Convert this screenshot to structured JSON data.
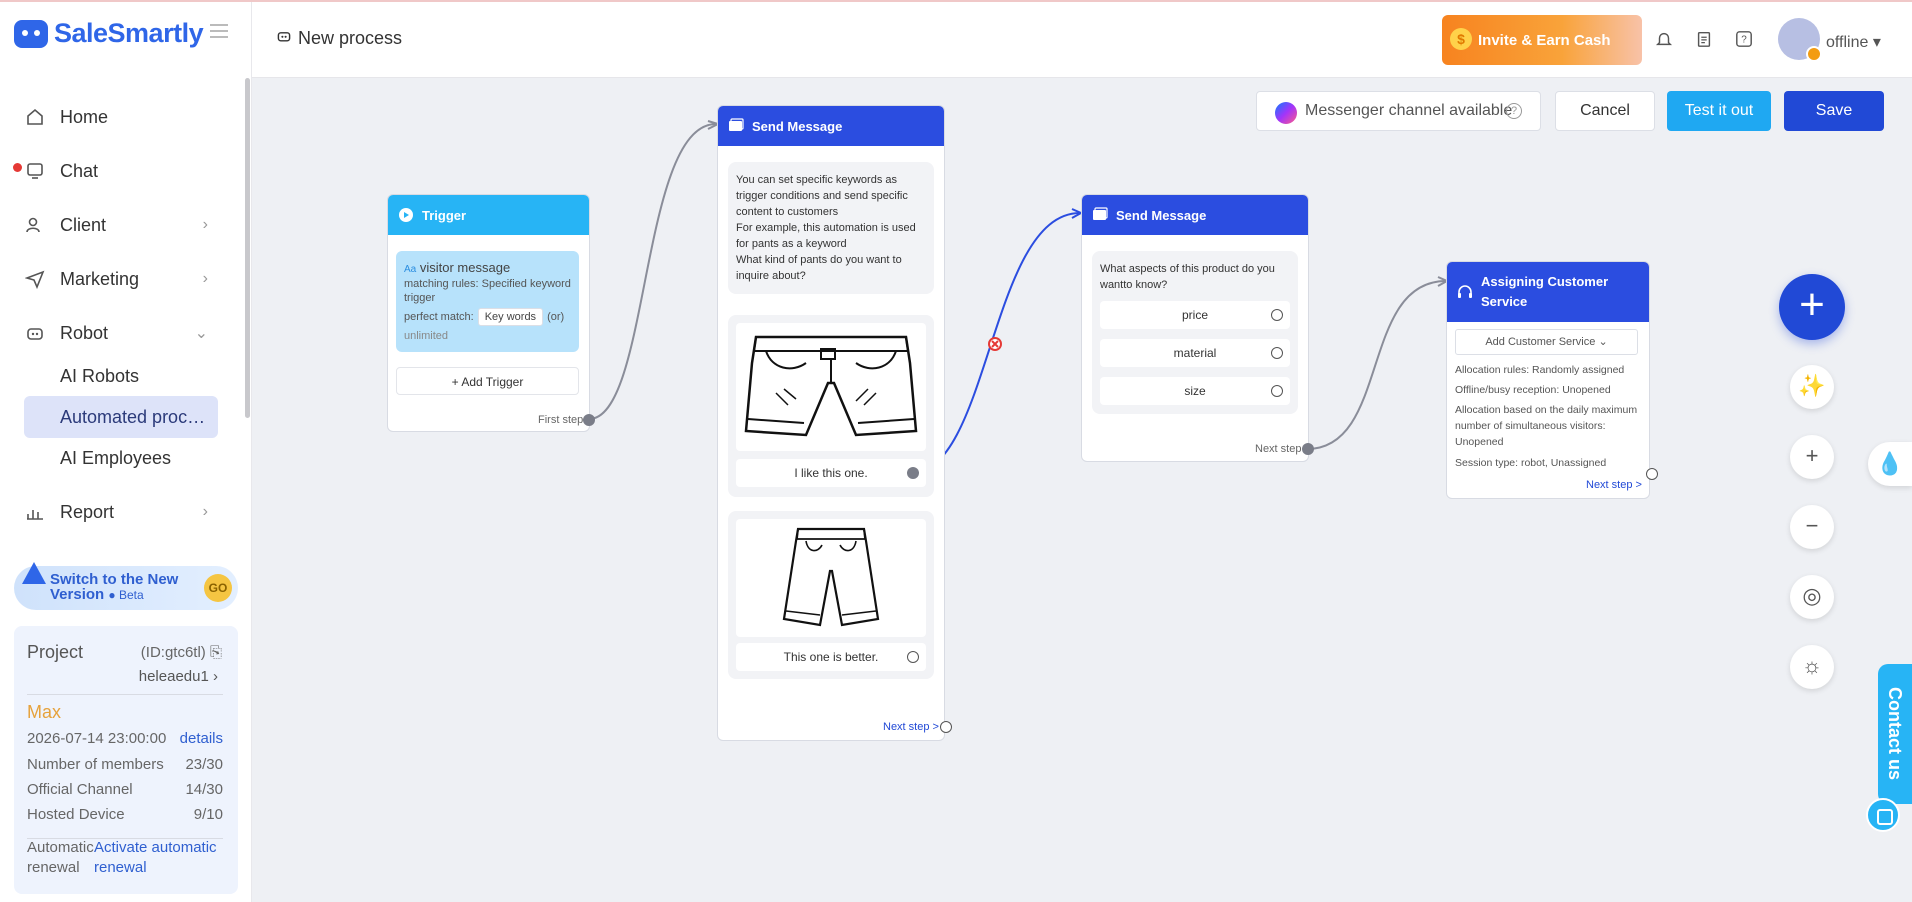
{
  "app": {
    "brand": "SaleSmartly",
    "process_title": "New process"
  },
  "sidebar": {
    "items": [
      {
        "label": "Home",
        "icon": "home-icon"
      },
      {
        "label": "Chat",
        "icon": "chat-icon"
      },
      {
        "label": "Client",
        "icon": "client-icon"
      },
      {
        "label": "Marketing",
        "icon": "marketing-icon"
      },
      {
        "label": "Robot",
        "icon": "robot-icon"
      },
      {
        "label": "Report",
        "icon": "report-icon"
      }
    ],
    "robot_sub": [
      "AI Robots",
      "Automated proc…",
      "AI Employees"
    ],
    "banner": {
      "line1": "Switch to the New",
      "line2": "Version",
      "beta": "● Beta"
    },
    "project": {
      "label": "Project",
      "id": "(ID:gtc6tl)",
      "user": "heleaedu1",
      "plan": "Max",
      "expiry": "2026-07-14 23:00:00",
      "details": "details",
      "rows": [
        {
          "label": "Number of members",
          "value": "23/30"
        },
        {
          "label": "Official Channel",
          "value": "14/30"
        },
        {
          "label": "Hosted Device",
          "value": "9/10"
        }
      ],
      "renew_label": "Automatic renewal",
      "renew_link": "Activate automatic renewal"
    }
  },
  "header": {
    "invite": "Invite & Earn Cash",
    "status": "offline"
  },
  "toolbar": {
    "messenger": "Messenger channel available",
    "cancel": "Cancel",
    "test": "Test it out",
    "save": "Save"
  },
  "trigger_card": {
    "title": "Trigger",
    "type": "visitor message",
    "rules": "matching rules: Specified keyword trigger",
    "perfect": "perfect match:",
    "keywords": "Key words",
    "or": "(or)",
    "limit": "unlimited",
    "add": "+ Add Trigger",
    "first_step": "First step"
  },
  "send1_card": {
    "title": "Send Message",
    "text_lines": [
      "You can set specific keywords as trigger conditions and send specific content to customers",
      "For example, this automation is used for pants as a keyword",
      "What kind of pants do you want to inquire about?"
    ],
    "option1": "I like this one.",
    "option2": "This one is better.",
    "next": "Next step >"
  },
  "send2_card": {
    "title": "Send Message",
    "question": "What aspects of this product do you wantto know?",
    "options": [
      "price",
      "material",
      "size"
    ],
    "next": "Next step"
  },
  "assign_card": {
    "title": "Assigning Customer Service",
    "select": "Add Customer Service",
    "lines": [
      "Allocation rules: Randomly assigned",
      "Offline/busy reception: Unopened",
      "Allocation based on the daily maximum number of simultaneous visitors: Unopened",
      "Session type: robot, Unassigned"
    ],
    "next": "Next step >"
  },
  "side_tools": {
    "contact": "Contact us"
  },
  "colors": {
    "primary": "#2149d6",
    "cyan": "#27b4f5",
    "send_head": "#2b4de0",
    "plan": "#e6a23c"
  }
}
